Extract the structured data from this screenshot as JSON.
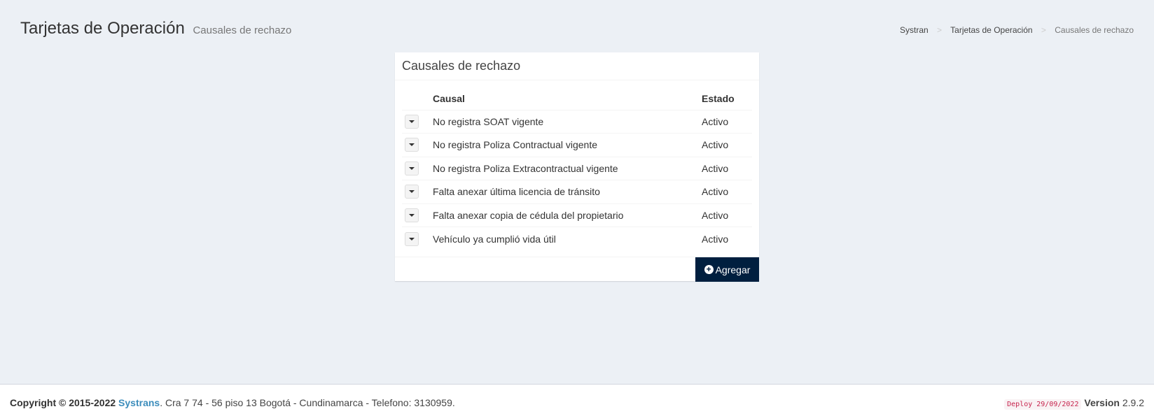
{
  "header": {
    "title": "Tarjetas de Operación",
    "subtitle": "Causales de rechazo"
  },
  "breadcrumb": {
    "items": [
      "Systran",
      "Tarjetas de Operación",
      "Causales de rechazo"
    ],
    "separator": ">"
  },
  "box": {
    "title": "Causales de rechazo",
    "columns": {
      "causal": "Causal",
      "estado": "Estado"
    },
    "rows": [
      {
        "causal": "No registra SOAT vigente",
        "estado": "Activo"
      },
      {
        "causal": "No registra Poliza Contractual vigente",
        "estado": "Activo"
      },
      {
        "causal": "No registra Poliza Extracontractual vigente",
        "estado": "Activo"
      },
      {
        "causal": "Falta anexar última licencia de tránsito",
        "estado": "Activo"
      },
      {
        "causal": "Falta anexar copia de cédula del propietario",
        "estado": "Activo"
      },
      {
        "causal": "Vehículo ya cumplió vida útil",
        "estado": "Activo"
      }
    ],
    "add_button_label": "Agregar",
    "add_icon": "plus-circle-icon"
  },
  "footer": {
    "copyright": "Copyright © 2015-2022",
    "brand": "Systrans",
    "address": ". Cra 7 74 - 56 piso 13 Bogotá - Cundinamarca - Telefono: 3130959.",
    "deploy": "Deploy 29/09/2022",
    "version_label": "Version",
    "version": "2.9.2"
  },
  "colors": {
    "background": "#ecf0f5",
    "add_button": "#001f3f",
    "brand_link": "#3c8dbc",
    "deploy_text": "#c7254e"
  }
}
